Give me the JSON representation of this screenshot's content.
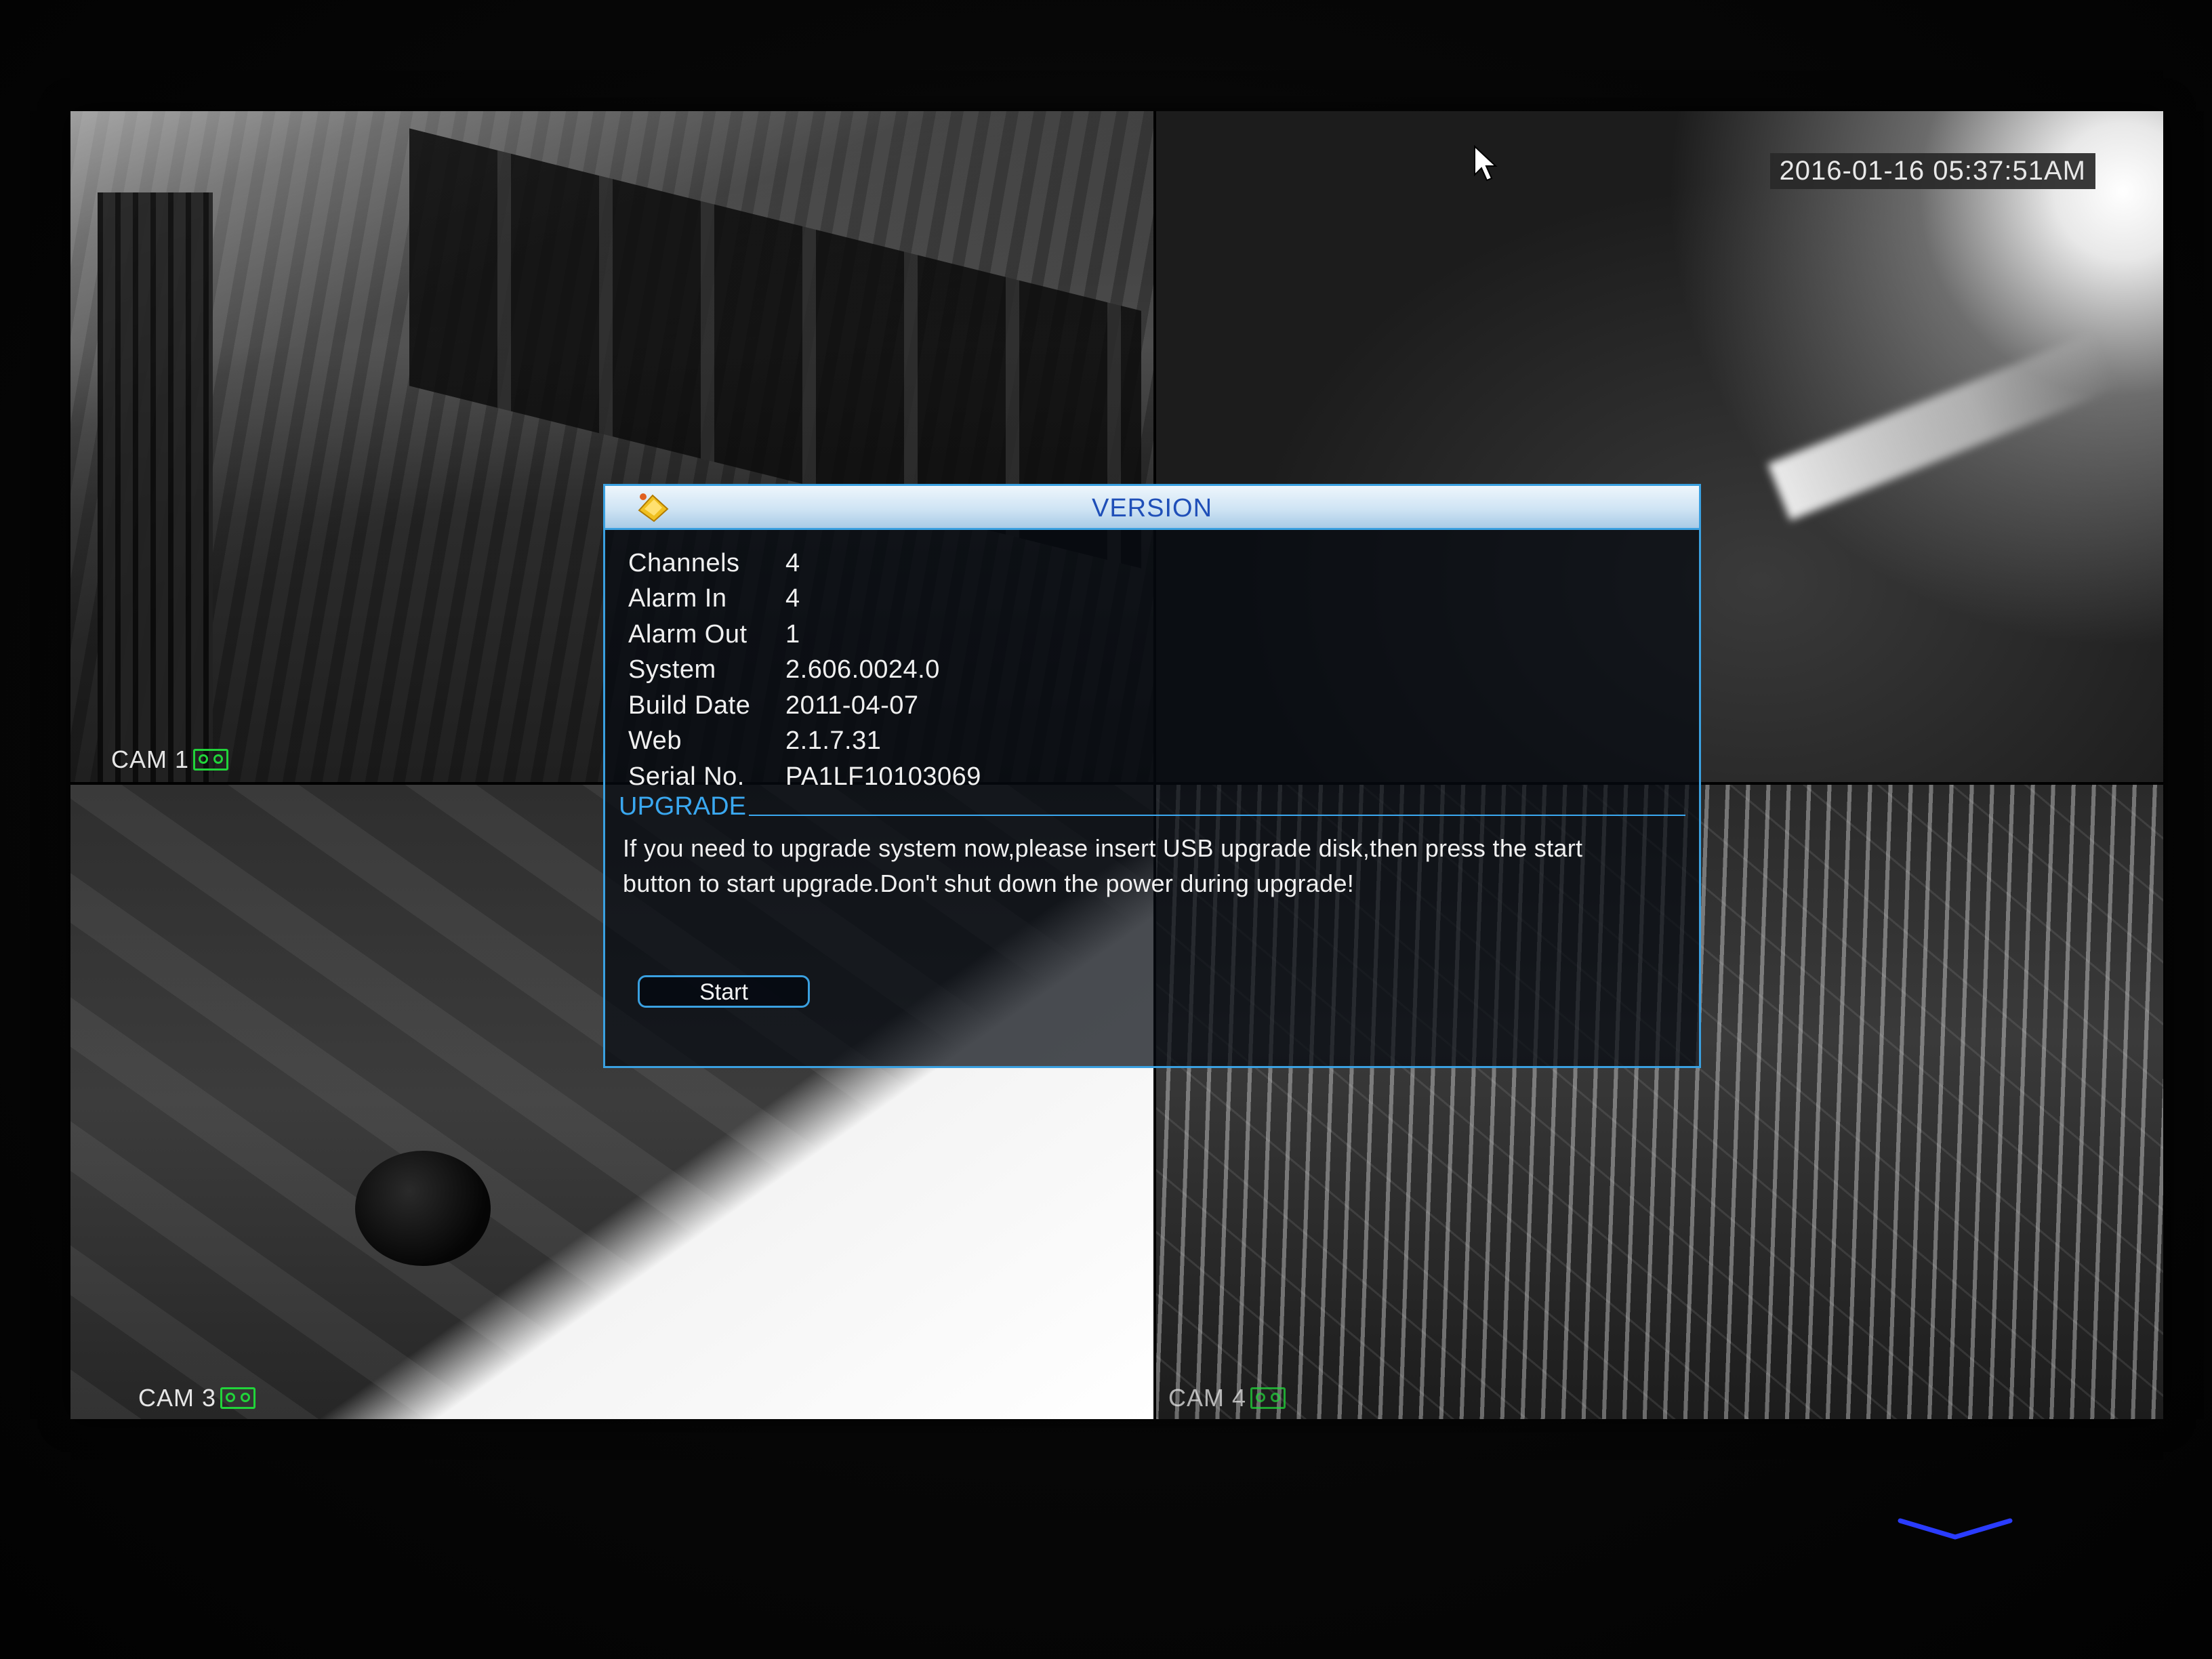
{
  "cameras": [
    {
      "label": "CAM 1",
      "recording_icon": "recording-icon"
    },
    {
      "label": "",
      "recording_icon": ""
    },
    {
      "label": "CAM 3",
      "recording_icon": "recording-icon"
    },
    {
      "label": "CAM 4",
      "recording_icon": "recording-icon"
    }
  ],
  "timestamp": "2016-01-16 05:37:51AM",
  "dialog": {
    "title": "VERSION",
    "logo_icon": "app-logo-icon",
    "info": [
      {
        "key": "Channels",
        "value": "4"
      },
      {
        "key": "Alarm In",
        "value": "4"
      },
      {
        "key": "Alarm Out",
        "value": "1"
      },
      {
        "key": "System",
        "value": "2.606.0024.0"
      },
      {
        "key": "Build Date",
        "value": "2011-04-07"
      },
      {
        "key": "Web",
        "value": "2.1.7.31"
      },
      {
        "key": "Serial No.",
        "value": "PA1LF10103069"
      }
    ],
    "upgrade": {
      "heading": "UPGRADE",
      "message": "If you need to upgrade system now,please insert USB upgrade disk,then press the start button to start upgrade.Don't shut down the power during upgrade!",
      "start_label": "Start"
    }
  },
  "colors": {
    "accent": "#3aa0e0",
    "title_text": "#1f4fb8",
    "record_green": "#21d43a"
  },
  "icons": {
    "cursor": "mouse-pointer-icon",
    "bezel_indicator": "chevron-down-icon"
  }
}
